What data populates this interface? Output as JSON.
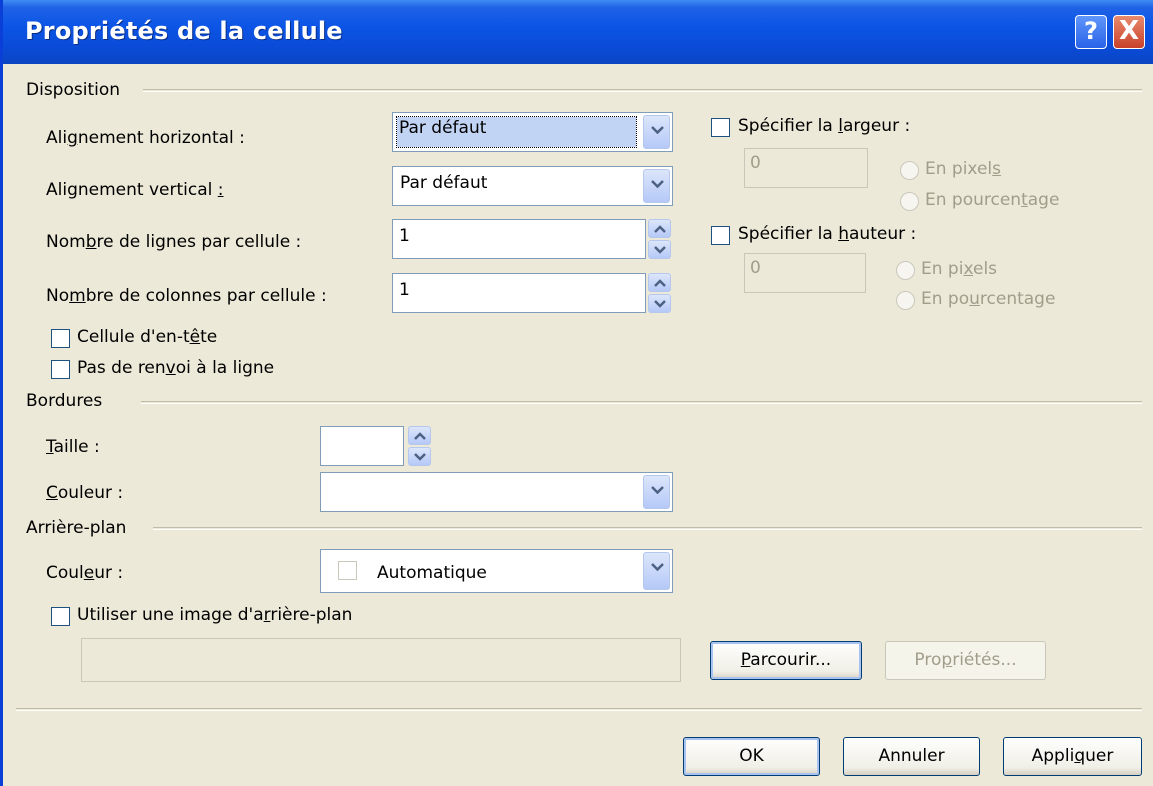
{
  "window": {
    "title": "Propriétés de la cellule",
    "help_label": "?",
    "close_label": "X"
  },
  "layout_section": {
    "title": "Disposition",
    "h_align": {
      "label_pre": "Ali",
      "label_u": "g",
      "label_post": "nement horizontal :",
      "value": "Par défaut"
    },
    "v_align": {
      "label_pre": "Alignement vertical ",
      "label_u": ":",
      "label_post": "",
      "value": "Par défaut"
    },
    "rows_per_cell": {
      "label_pre": "Nom",
      "label_u": "b",
      "label_post": "re de lignes par cellule :",
      "value": "1"
    },
    "cols_per_cell": {
      "label_pre": "No",
      "label_u": "m",
      "label_post": "bre de colonnes par cellule :",
      "value": "1"
    },
    "header_cell": {
      "label_pre": "Cellule d'en-t",
      "label_u": "ê",
      "label_post": "te",
      "checked": false
    },
    "no_wrap": {
      "label_pre": "Pas de ren",
      "label_u": "v",
      "label_post": "oi à la ligne",
      "checked": false
    },
    "width": {
      "label_pre": "Spécifier la ",
      "label_u": "l",
      "label_post": "argeur :",
      "checked": false,
      "value": "0",
      "pixels_pre": "En pixel",
      "pixels_u": "s",
      "pixels_post": "",
      "percent_pre": "En pourcen",
      "percent_u": "t",
      "percent_post": "age"
    },
    "height": {
      "label_pre": "Spécifier la ",
      "label_u": "h",
      "label_post": "auteur :",
      "checked": false,
      "value": "0",
      "pixels_pre": "En pi",
      "pixels_u": "x",
      "pixels_post": "els",
      "percent_pre": "En po",
      "percent_u": "u",
      "percent_post": "rcentage"
    }
  },
  "borders_section": {
    "title": "Bordures",
    "size": {
      "label_u": "T",
      "label_post": "aille :",
      "value": ""
    },
    "color": {
      "label_u": "C",
      "label_post": "ouleur :",
      "value": ""
    }
  },
  "background_section": {
    "title": "Arrière-plan",
    "color": {
      "label_pre": "Coul",
      "label_u": "e",
      "label_post": "ur :",
      "value": "Automatique"
    },
    "use_image": {
      "label_pre": "Utiliser une image d'a",
      "label_u": "r",
      "label_post": "rière-plan",
      "checked": false
    },
    "image_path": "",
    "browse": {
      "label_u": "P",
      "label_post": "arcourir..."
    },
    "properties": {
      "label_pre": "Pro",
      "label_u": "p",
      "label_post": "riétés..."
    }
  },
  "footer": {
    "ok": "OK",
    "cancel": "Annuler",
    "apply_pre": "Appli",
    "apply_u": "q",
    "apply_post": "uer"
  }
}
